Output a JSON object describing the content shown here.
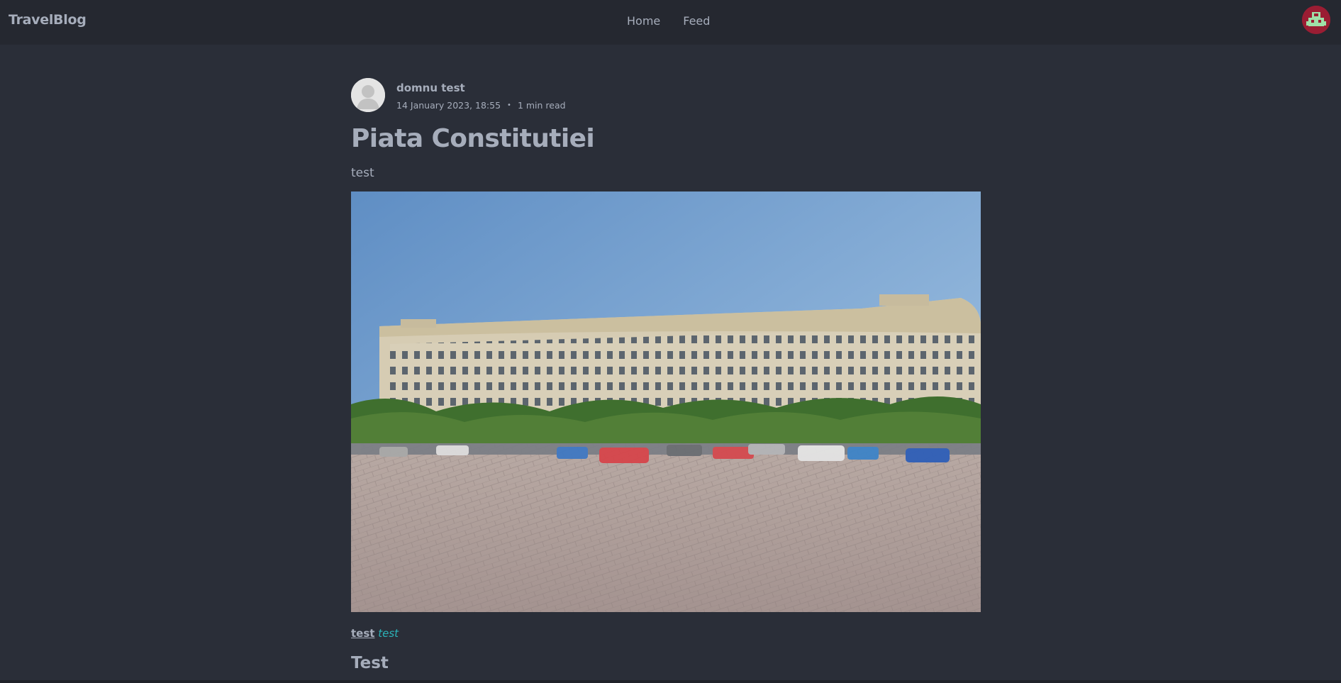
{
  "navbar": {
    "brand": "TravelBlog",
    "links": [
      {
        "label": "Home"
      },
      {
        "label": "Feed"
      }
    ],
    "avatar_icon": "user-avatar-icon"
  },
  "post": {
    "author": "domnu test",
    "date": "14 January 2023, 18:55",
    "separator": "•",
    "read_time": "1 min read",
    "title": "Piata Constitutiei",
    "description": "test",
    "image_icon": "photo-building-icon",
    "body_bold": "test",
    "body_italic": "test",
    "subheading": "Test"
  },
  "colors": {
    "background": "#2a2e38",
    "navbar": "#252830",
    "text": "#a6adbb",
    "accent": "#2bb3b8",
    "avatar_bg": "#9a1d33"
  }
}
